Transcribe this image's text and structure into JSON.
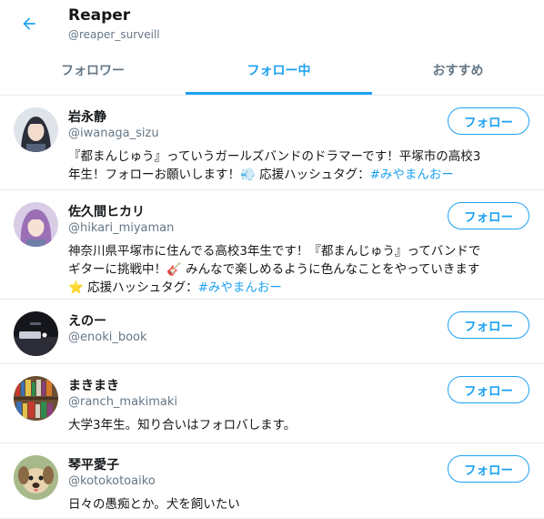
{
  "header": {
    "title": "Reaper",
    "handle": "@reaper_surveill"
  },
  "tabs": [
    {
      "label": "フォロワー"
    },
    {
      "label": "フォロー中"
    },
    {
      "label": "おすすめ"
    }
  ],
  "users": [
    {
      "name": "岩永静",
      "handle": "@iwanaga_sizu",
      "bio_lines": [
        "『都まんじゅう』っていうガールズバンドのドラマーです！平塚市の高校3",
        "年生！フォローお願いします！💨 応援ハッシュタグ："
      ],
      "hashtag": "#みやまんおー",
      "follow_label": "フォロー",
      "avatar_color": "#6b7a8a"
    },
    {
      "name": "佐久間ヒカリ",
      "handle": "@hikari_miyaman",
      "bio_lines": [
        "神奈川県平塚市に住んでる高校3年生です！『都まんじゅう』ってバンドで",
        "ギターに挑戦中！🎸 みんなで楽しめるように色んなことをやっていきます",
        "⭐ 応援ハッシュタグ："
      ],
      "hashtag": "#みやまんおー",
      "follow_label": "フォロー",
      "avatar_color": "#b088c8"
    },
    {
      "name": "えのー",
      "handle": "@enoki_book",
      "bio_lines": [],
      "hashtag": "",
      "follow_label": "フォロー",
      "avatar_color": "#2a2a33"
    },
    {
      "name": "まきまき",
      "handle": "@ranch_makimaki",
      "bio_lines": [
        "大学3年生。知り合いはフォロバします。"
      ],
      "hashtag": "",
      "follow_label": "フォロー",
      "avatar_color": "#8a6a4a"
    },
    {
      "name": "琴平愛子",
      "handle": "@kotokotoaiko",
      "bio_lines": [
        "日々の愚痴とか。犬を飼いたい"
      ],
      "hashtag": "",
      "follow_label": "フォロー",
      "avatar_color": "#c8b890"
    }
  ],
  "colors": {
    "accent": "#1da1f2",
    "muted": "#657786",
    "divider": "#e6ecf0"
  },
  "icons": {
    "back": "back-arrow-icon"
  }
}
